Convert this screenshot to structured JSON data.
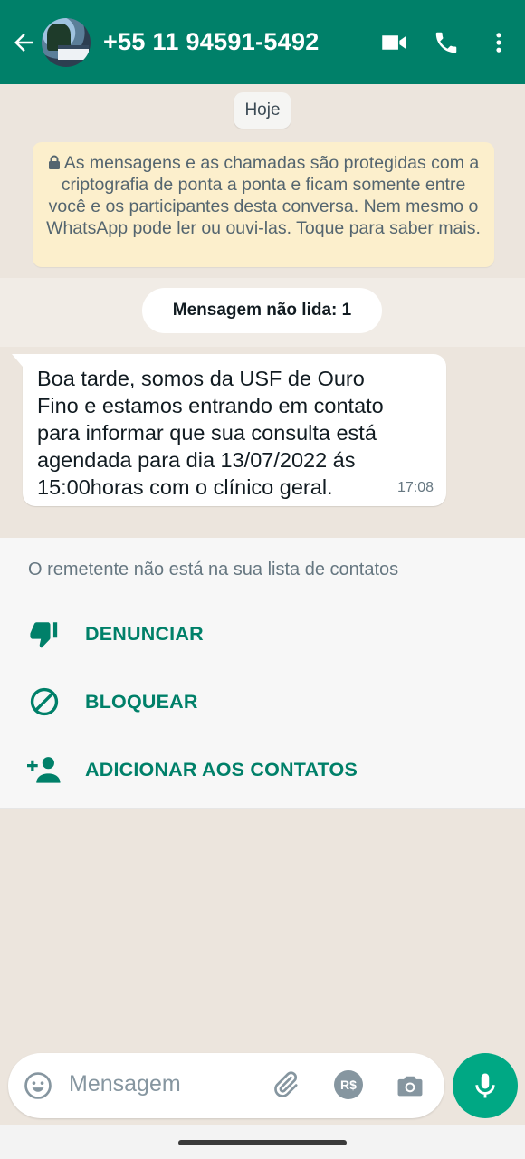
{
  "header": {
    "contact_name": "+55 11 94591-5492",
    "background_color": "#008069",
    "icons": [
      "back-arrow-icon",
      "avatar",
      "video-call-icon",
      "voice-call-icon",
      "more-options-icon"
    ]
  },
  "chat": {
    "day_label": "Hoje",
    "encryption_notice": "As mensagens e as chamadas são protegidas com a criptografia de ponta a ponta e ficam somente entre você e os participantes desta conversa. Nem mesmo o WhatsApp pode ler ou ouvi-las. Toque para saber mais.",
    "unread_label": "Mensagem não lida: 1",
    "message": {
      "text": "Boa tarde, somos da USF de Ouro Fino e estamos entrando em contato para informar que sua consulta está agendada para dia 13/07/2022 ás 15:00horas com o clínico geral.",
      "time": "17:08"
    }
  },
  "unknown_sender_panel": {
    "notice": "O remetente não está na sua lista de contatos",
    "actions": [
      {
        "label": "DENUNCIAR",
        "icon": "thumbs-down-icon"
      },
      {
        "label": "BLOQUEAR",
        "icon": "block-icon"
      },
      {
        "label": "ADICIONAR AOS CONTATOS",
        "icon": "add-contact-icon"
      }
    ],
    "accent_color": "#008069"
  },
  "composer": {
    "placeholder": "Mensagem",
    "payment_badge": "R$",
    "mic_color": "#00a884"
  }
}
